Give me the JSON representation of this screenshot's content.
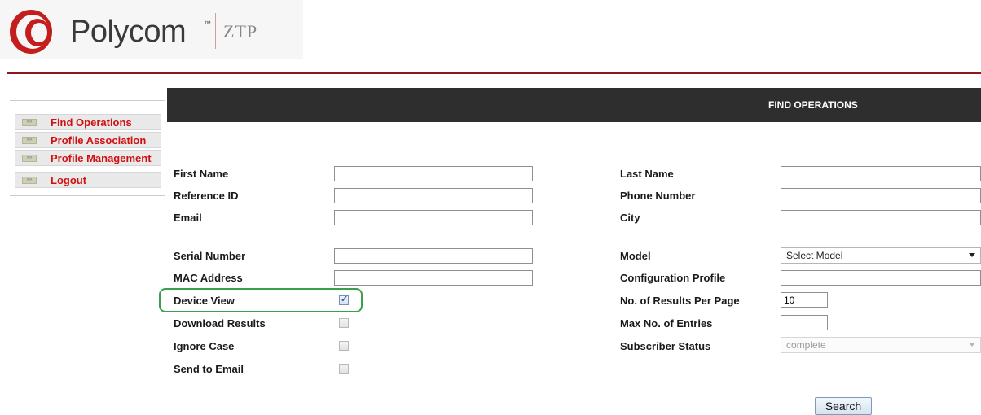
{
  "logo": {
    "brand": "Polycom",
    "tm": "™",
    "product": "ZTP"
  },
  "sidebar": {
    "items": [
      {
        "label": "Find Operations",
        "icon": "nav-arrow-icon"
      },
      {
        "label": "Profile Association",
        "icon": "nav-arrow-icon"
      },
      {
        "label": "Profile Management",
        "icon": "nav-arrow-icon"
      },
      {
        "label": "Logout",
        "icon": "nav-arrow-icon"
      }
    ]
  },
  "main": {
    "title": "FIND OPERATIONS"
  },
  "form": {
    "left": {
      "first_name": {
        "label": "First Name",
        "value": ""
      },
      "reference_id": {
        "label": "Reference ID",
        "value": ""
      },
      "email": {
        "label": "Email",
        "value": ""
      },
      "serial_number": {
        "label": "Serial Number",
        "value": ""
      },
      "mac_address": {
        "label": "MAC Address",
        "value": ""
      },
      "device_view": {
        "label": "Device View",
        "checked": true
      },
      "download_results": {
        "label": "Download Results",
        "checked": false
      },
      "ignore_case": {
        "label": "Ignore Case",
        "checked": false
      },
      "send_to_email": {
        "label": "Send to Email",
        "checked": false
      }
    },
    "right": {
      "last_name": {
        "label": "Last Name",
        "value": ""
      },
      "phone_number": {
        "label": "Phone Number",
        "value": ""
      },
      "city": {
        "label": "City",
        "value": ""
      },
      "model": {
        "label": "Model",
        "selected": "Select Model"
      },
      "configuration_profile": {
        "label": "Configuration Profile",
        "value": ""
      },
      "results_per_page": {
        "label": "No. of Results Per Page",
        "value": "10"
      },
      "max_entries": {
        "label": "Max No. of Entries",
        "value": ""
      },
      "subscriber_status": {
        "label": "Subscriber Status",
        "selected": "complete"
      }
    },
    "search_label": "Search"
  },
  "colors": {
    "accent_red": "#d01010",
    "rule": "#8a1a1a",
    "bar": "#2e2e2e",
    "highlight": "#3aa04a"
  }
}
